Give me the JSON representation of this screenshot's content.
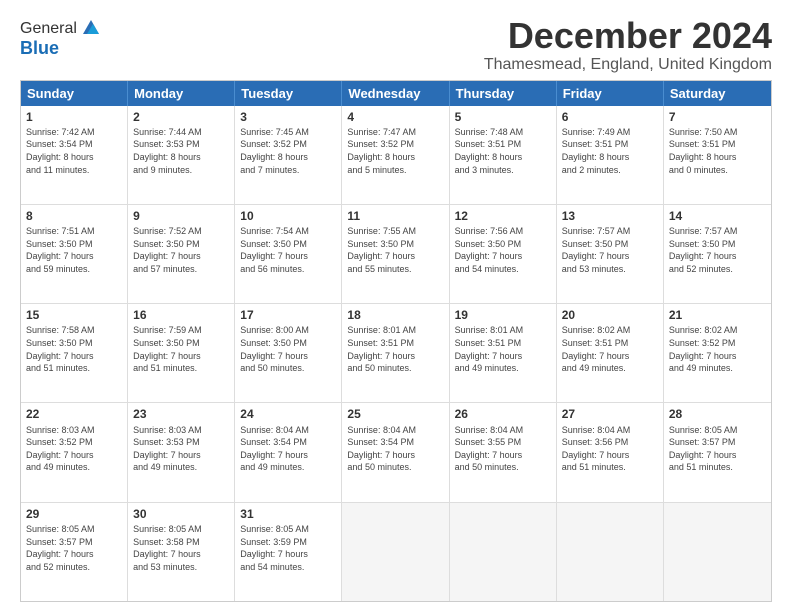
{
  "logo": {
    "line1": "General",
    "line2": "Blue"
  },
  "title": "December 2024",
  "subtitle": "Thamesmead, England, United Kingdom",
  "calendar": {
    "headers": [
      "Sunday",
      "Monday",
      "Tuesday",
      "Wednesday",
      "Thursday",
      "Friday",
      "Saturday"
    ],
    "rows": [
      [
        {
          "day": "1",
          "lines": [
            "Sunrise: 7:42 AM",
            "Sunset: 3:54 PM",
            "Daylight: 8 hours",
            "and 11 minutes."
          ]
        },
        {
          "day": "2",
          "lines": [
            "Sunrise: 7:44 AM",
            "Sunset: 3:53 PM",
            "Daylight: 8 hours",
            "and 9 minutes."
          ]
        },
        {
          "day": "3",
          "lines": [
            "Sunrise: 7:45 AM",
            "Sunset: 3:52 PM",
            "Daylight: 8 hours",
            "and 7 minutes."
          ]
        },
        {
          "day": "4",
          "lines": [
            "Sunrise: 7:47 AM",
            "Sunset: 3:52 PM",
            "Daylight: 8 hours",
            "and 5 minutes."
          ]
        },
        {
          "day": "5",
          "lines": [
            "Sunrise: 7:48 AM",
            "Sunset: 3:51 PM",
            "Daylight: 8 hours",
            "and 3 minutes."
          ]
        },
        {
          "day": "6",
          "lines": [
            "Sunrise: 7:49 AM",
            "Sunset: 3:51 PM",
            "Daylight: 8 hours",
            "and 2 minutes."
          ]
        },
        {
          "day": "7",
          "lines": [
            "Sunrise: 7:50 AM",
            "Sunset: 3:51 PM",
            "Daylight: 8 hours",
            "and 0 minutes."
          ]
        }
      ],
      [
        {
          "day": "8",
          "lines": [
            "Sunrise: 7:51 AM",
            "Sunset: 3:50 PM",
            "Daylight: 7 hours",
            "and 59 minutes."
          ]
        },
        {
          "day": "9",
          "lines": [
            "Sunrise: 7:52 AM",
            "Sunset: 3:50 PM",
            "Daylight: 7 hours",
            "and 57 minutes."
          ]
        },
        {
          "day": "10",
          "lines": [
            "Sunrise: 7:54 AM",
            "Sunset: 3:50 PM",
            "Daylight: 7 hours",
            "and 56 minutes."
          ]
        },
        {
          "day": "11",
          "lines": [
            "Sunrise: 7:55 AM",
            "Sunset: 3:50 PM",
            "Daylight: 7 hours",
            "and 55 minutes."
          ]
        },
        {
          "day": "12",
          "lines": [
            "Sunrise: 7:56 AM",
            "Sunset: 3:50 PM",
            "Daylight: 7 hours",
            "and 54 minutes."
          ]
        },
        {
          "day": "13",
          "lines": [
            "Sunrise: 7:57 AM",
            "Sunset: 3:50 PM",
            "Daylight: 7 hours",
            "and 53 minutes."
          ]
        },
        {
          "day": "14",
          "lines": [
            "Sunrise: 7:57 AM",
            "Sunset: 3:50 PM",
            "Daylight: 7 hours",
            "and 52 minutes."
          ]
        }
      ],
      [
        {
          "day": "15",
          "lines": [
            "Sunrise: 7:58 AM",
            "Sunset: 3:50 PM",
            "Daylight: 7 hours",
            "and 51 minutes."
          ]
        },
        {
          "day": "16",
          "lines": [
            "Sunrise: 7:59 AM",
            "Sunset: 3:50 PM",
            "Daylight: 7 hours",
            "and 51 minutes."
          ]
        },
        {
          "day": "17",
          "lines": [
            "Sunrise: 8:00 AM",
            "Sunset: 3:50 PM",
            "Daylight: 7 hours",
            "and 50 minutes."
          ]
        },
        {
          "day": "18",
          "lines": [
            "Sunrise: 8:01 AM",
            "Sunset: 3:51 PM",
            "Daylight: 7 hours",
            "and 50 minutes."
          ]
        },
        {
          "day": "19",
          "lines": [
            "Sunrise: 8:01 AM",
            "Sunset: 3:51 PM",
            "Daylight: 7 hours",
            "and 49 minutes."
          ]
        },
        {
          "day": "20",
          "lines": [
            "Sunrise: 8:02 AM",
            "Sunset: 3:51 PM",
            "Daylight: 7 hours",
            "and 49 minutes."
          ]
        },
        {
          "day": "21",
          "lines": [
            "Sunrise: 8:02 AM",
            "Sunset: 3:52 PM",
            "Daylight: 7 hours",
            "and 49 minutes."
          ]
        }
      ],
      [
        {
          "day": "22",
          "lines": [
            "Sunrise: 8:03 AM",
            "Sunset: 3:52 PM",
            "Daylight: 7 hours",
            "and 49 minutes."
          ]
        },
        {
          "day": "23",
          "lines": [
            "Sunrise: 8:03 AM",
            "Sunset: 3:53 PM",
            "Daylight: 7 hours",
            "and 49 minutes."
          ]
        },
        {
          "day": "24",
          "lines": [
            "Sunrise: 8:04 AM",
            "Sunset: 3:54 PM",
            "Daylight: 7 hours",
            "and 49 minutes."
          ]
        },
        {
          "day": "25",
          "lines": [
            "Sunrise: 8:04 AM",
            "Sunset: 3:54 PM",
            "Daylight: 7 hours",
            "and 50 minutes."
          ]
        },
        {
          "day": "26",
          "lines": [
            "Sunrise: 8:04 AM",
            "Sunset: 3:55 PM",
            "Daylight: 7 hours",
            "and 50 minutes."
          ]
        },
        {
          "day": "27",
          "lines": [
            "Sunrise: 8:04 AM",
            "Sunset: 3:56 PM",
            "Daylight: 7 hours",
            "and 51 minutes."
          ]
        },
        {
          "day": "28",
          "lines": [
            "Sunrise: 8:05 AM",
            "Sunset: 3:57 PM",
            "Daylight: 7 hours",
            "and 51 minutes."
          ]
        }
      ],
      [
        {
          "day": "29",
          "lines": [
            "Sunrise: 8:05 AM",
            "Sunset: 3:57 PM",
            "Daylight: 7 hours",
            "and 52 minutes."
          ]
        },
        {
          "day": "30",
          "lines": [
            "Sunrise: 8:05 AM",
            "Sunset: 3:58 PM",
            "Daylight: 7 hours",
            "and 53 minutes."
          ]
        },
        {
          "day": "31",
          "lines": [
            "Sunrise: 8:05 AM",
            "Sunset: 3:59 PM",
            "Daylight: 7 hours",
            "and 54 minutes."
          ]
        },
        {
          "day": "",
          "lines": []
        },
        {
          "day": "",
          "lines": []
        },
        {
          "day": "",
          "lines": []
        },
        {
          "day": "",
          "lines": []
        }
      ]
    ]
  }
}
